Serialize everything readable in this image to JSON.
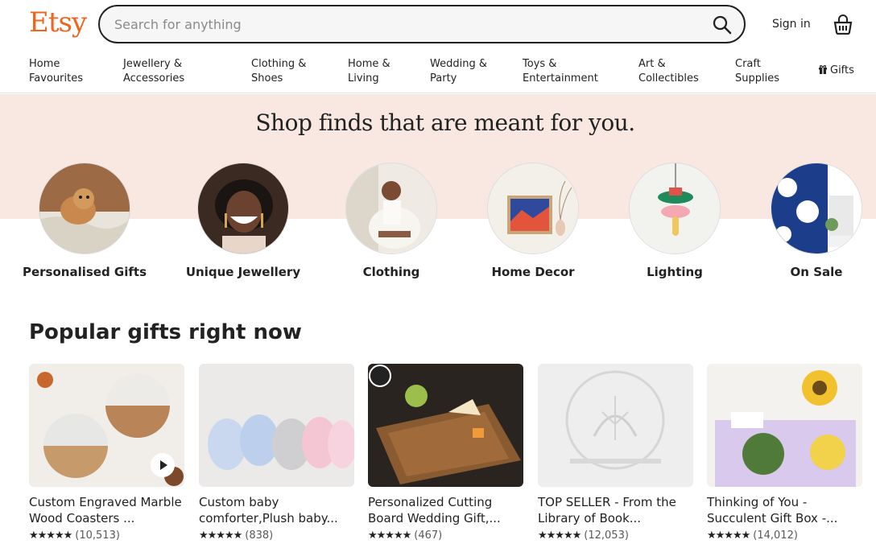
{
  "header": {
    "logo": "Etsy",
    "search_placeholder": "Search for anything",
    "signin_label": "Sign in"
  },
  "nav": {
    "items": [
      {
        "line1": "Home",
        "line2": "Favourites"
      },
      {
        "line1": "Jewellery &",
        "line2": "Accessories"
      },
      {
        "line1": "Clothing &",
        "line2": "Shoes"
      },
      {
        "line1": "Home &",
        "line2": "Living"
      },
      {
        "line1": "Wedding &",
        "line2": "Party"
      },
      {
        "line1": "Toys &",
        "line2": "Entertainment"
      },
      {
        "line1": "Art &",
        "line2": "Collectibles"
      },
      {
        "line1": "Craft",
        "line2": "Supplies"
      }
    ],
    "gifts_label": "Gifts"
  },
  "hero": {
    "title": "Shop finds that are meant for you.",
    "categories": [
      {
        "label": "Personalised Gifts"
      },
      {
        "label": "Unique Jewellery"
      },
      {
        "label": "Clothing"
      },
      {
        "label": "Home Decor"
      },
      {
        "label": "Lighting"
      },
      {
        "label": "On Sale"
      }
    ]
  },
  "popular": {
    "title": "Popular gifts right now",
    "items": [
      {
        "title": "Custom Engraved Marble Wood Coasters ...",
        "rating": 5,
        "stars": "★★★★★",
        "reviews": "(10,513)"
      },
      {
        "title": "Custom baby comforter,Plush baby...",
        "rating": 5,
        "stars": "★★★★★",
        "reviews": "(838)"
      },
      {
        "title": "Personalized Cutting Board Wedding Gift,...",
        "rating": 5,
        "stars": "★★★★★",
        "reviews": "(467)"
      },
      {
        "title": "TOP SELLER - From the Library of Book...",
        "rating": 5,
        "stars": "★★★★★",
        "reviews": "(12,053)"
      },
      {
        "title": "Thinking of You - Succulent Gift Box -...",
        "rating": 5,
        "stars": "★★★★★",
        "reviews": "(14,012)"
      }
    ]
  },
  "colors": {
    "brand": "#f1641e",
    "hero_bg": "#f8e8e1",
    "text": "#222222"
  },
  "icons": {
    "search": "search-icon",
    "cart": "shopping-basket-icon",
    "gifts": "gift-icon",
    "play": "play-icon"
  }
}
